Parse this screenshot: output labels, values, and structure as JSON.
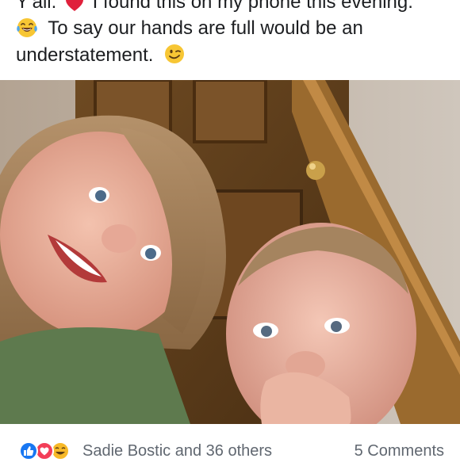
{
  "post": {
    "line1_a": "Y'all.",
    "line1_b": "I found this on my phone this evening.",
    "line2": "To say our hands are full would be an",
    "line3": "understatement.",
    "emoji_names": [
      "heart-emoji",
      "laughing-tears-emoji",
      "winking-emoji"
    ]
  },
  "photo": {
    "description_icon": "selfie-photo"
  },
  "footer": {
    "reaction_icons": [
      "like-icon",
      "love-icon",
      "haha-icon"
    ],
    "reaction_names": "Sadie Bostic and 36 others",
    "comment_count": "5 Comments"
  },
  "colors": {
    "like_blue": "#1877f2",
    "love_red": "#f33e58",
    "haha_yellow": "#f7b928",
    "text": "#1c1e21",
    "meta_text": "#606770"
  }
}
